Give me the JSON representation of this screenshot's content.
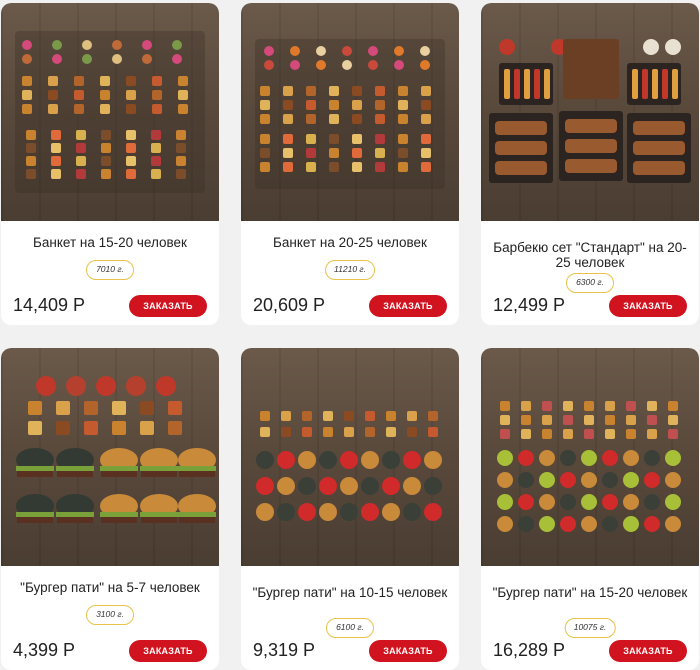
{
  "products": [
    {
      "title": "Банкет на 15-20 человек",
      "weight": "7010 г.",
      "price": "14,409 Р",
      "button": "ЗАКАЗАТЬ"
    },
    {
      "title": "Банкет на 20-25 человек",
      "weight": "11210 г.",
      "price": "20,609 Р",
      "button": "ЗАКАЗАТЬ"
    },
    {
      "title": "Барбекю сет \"Стандарт\" на 20-25 человек",
      "weight": "6300 г.",
      "price": "12,499 Р",
      "button": "ЗАКАЗАТЬ"
    },
    {
      "title": "\"Бургер пати\" на 5-7 человек",
      "weight": "3100 г.",
      "price": "4,399 Р",
      "button": "ЗАКАЗАТЬ"
    },
    {
      "title": "\"Бургер пати\" на 10-15 человек",
      "weight": "6100 г.",
      "price": "9,319 Р",
      "button": "ЗАКАЗАТЬ"
    },
    {
      "title": "\"Бургер пати\" на 15-20 человек",
      "weight": "10075 г.",
      "price": "16,289 Р",
      "button": "ЗАКАЗАТЬ"
    }
  ],
  "colors": {
    "accent": "#d0131e",
    "weight_border": "#e8c24a",
    "background": "#f1f1f1",
    "card": "#ffffff"
  }
}
